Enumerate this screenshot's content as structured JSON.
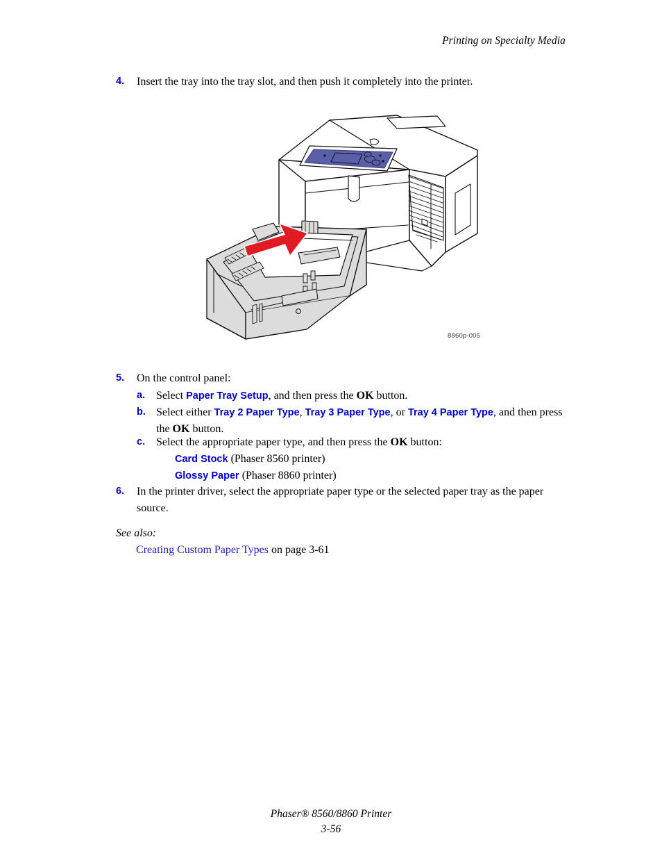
{
  "header": {
    "running_title": "Printing on Specialty Media"
  },
  "steps": {
    "step4": {
      "number": "4.",
      "text": "Insert the tray into the tray slot, and then push it completely into the printer."
    },
    "step5": {
      "number": "5.",
      "text": "On the control panel:",
      "substeps": {
        "a": {
          "letter": "a.",
          "pre": "Select ",
          "ui_1": "Paper Tray Setup",
          "mid": ", and then press the ",
          "ok": "OK",
          "post": " button."
        },
        "b": {
          "letter": "b.",
          "pre": "Select either ",
          "ui_1": "Tray 2 Paper Type",
          "sep_1": ", ",
          "ui_2": "Tray 3 Paper Type",
          "sep_2": ", or ",
          "ui_3": "Tray 4 Paper Type",
          "mid": ", and then press the ",
          "ok": "OK",
          "post": " button."
        },
        "c": {
          "letter": "c.",
          "pre": "Select the appropriate paper type, and then press the ",
          "ok": "OK",
          "post": " button:",
          "options": [
            {
              "name": "Card Stock",
              "note": " (Phaser 8560 printer)"
            },
            {
              "name": "Glossy Paper",
              "note": " (Phaser 8860 printer)"
            }
          ]
        }
      }
    },
    "step6": {
      "number": "6.",
      "text": "In the printer driver, select the appropriate paper type or the selected paper tray as the paper source."
    }
  },
  "see_also": {
    "label": "See also:",
    "link_text": "Creating Custom Paper Types",
    "link_suffix": " on page 3-61"
  },
  "figure": {
    "caption": "8860p-005",
    "alt": "Solid-ink printer with paper tray partially pulled out; red arrow indicates pushing the tray into the printer",
    "colors": {
      "control_panel": "#5B5FA8",
      "arrow": "#E01B24",
      "tray_body": "#DCDCDC",
      "tray_shadow": "#C8C8C8",
      "outline": "#111111",
      "paper": "#FFFFFF"
    }
  },
  "footer": {
    "product": "Phaser® 8560/8860 Printer",
    "page_number": "3-56"
  },
  "colors": {
    "ui_blue": "#0000CC",
    "link_blue": "#2222CC",
    "text": "#000000",
    "page_background": "#FFFFFF"
  }
}
